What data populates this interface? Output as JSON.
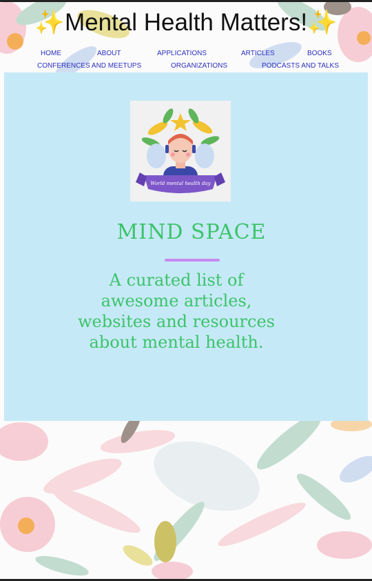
{
  "header": {
    "title": "✨Mental Health Matters!✨"
  },
  "nav": {
    "items": [
      {
        "label": "HOME"
      },
      {
        "label": "ABOUT"
      },
      {
        "label": "APPLICATIONS"
      },
      {
        "label": "ARTICLES"
      },
      {
        "label": "BOOKS"
      },
      {
        "label": "CONFERENCES AND MEETUPS"
      },
      {
        "label": "ORGANIZATIONS"
      },
      {
        "label": "PODCASTS AND TALKS"
      }
    ],
    "link_color": "#2b2fbf"
  },
  "card": {
    "background": "#c6e9f7",
    "image_banner_text": "World mental health day",
    "heading": "MIND SPACE",
    "tagline": "A curated list of awesome articles, websites and resources about mental health.",
    "accent_color": "#3cc36a",
    "divider_color": "#c48cf0"
  }
}
